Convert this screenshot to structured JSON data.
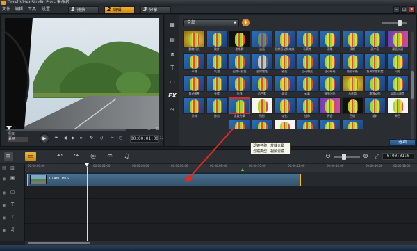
{
  "window": {
    "title": "Corel VideoStudio Pro - 未命名"
  },
  "menu": {
    "items": [
      "文件",
      "编辑",
      "工具",
      "设置"
    ]
  },
  "steps": [
    {
      "num": "1",
      "label": "捕获"
    },
    {
      "num": "2",
      "label": "编辑"
    },
    {
      "num": "3",
      "label": "分享"
    }
  ],
  "player": {
    "mode_project": "项目",
    "mode_clip": "素材",
    "timecode": "00:00:01:00"
  },
  "library": {
    "gallery": "全部",
    "options_label": "选项",
    "tiles": [
      "翻转闪光",
      "胶片",
      "老电影",
      "油画",
      "视频摇动和缩放",
      "马赛克",
      "浮雕",
      "模糊",
      "画中画",
      "漫画卡通",
      "平铺",
      "气泡",
      "去除马赛克",
      "去除雪花",
      "锐化",
      "自动曝光",
      "自动草绘",
      "色彩平衡",
      "色调和饱和度",
      "闪电",
      "自动调整",
      "亮度",
      "光线",
      "彩色笔",
      "雨点",
      "云彩",
      "镜头闪光",
      "万花筒",
      "缩放动作",
      "局部马赛克",
      "涂抹",
      "修剪",
      "发散光晕",
      "残影",
      "淡化",
      "镜像",
      "怀旧",
      "色调",
      "翻转",
      "单色"
    ],
    "extra_tiles": [
      "",
      "",
      "",
      "",
      "",
      ""
    ]
  },
  "tooltip": {
    "line1": "滤镜名称：发散光晕",
    "line2": "滤镜类型：视频滤镜"
  },
  "timeline": {
    "timecode": "0:00:01:0",
    "ruler_ticks": [
      "00:00:00:00",
      "00:00:02:00",
      "00:00:04:00",
      "00:00:06:00",
      "00:00:08:00",
      "00:00:10:00",
      "00:00:12:00",
      "00:00:14:00",
      "00:00:16:00",
      "00:00:18:00"
    ],
    "clip_name": "01460.MTS"
  },
  "colors": {
    "accent": "#e8a020",
    "selection_border": "#e22a1f",
    "clip_handle": "#f2c21a",
    "options_button": "#2f5f96"
  },
  "icons": {
    "play": "play-icon",
    "library_tools": [
      "media-icon",
      "transition-icon",
      "title-icon",
      "graphic-icon",
      "filter-icon"
    ]
  }
}
